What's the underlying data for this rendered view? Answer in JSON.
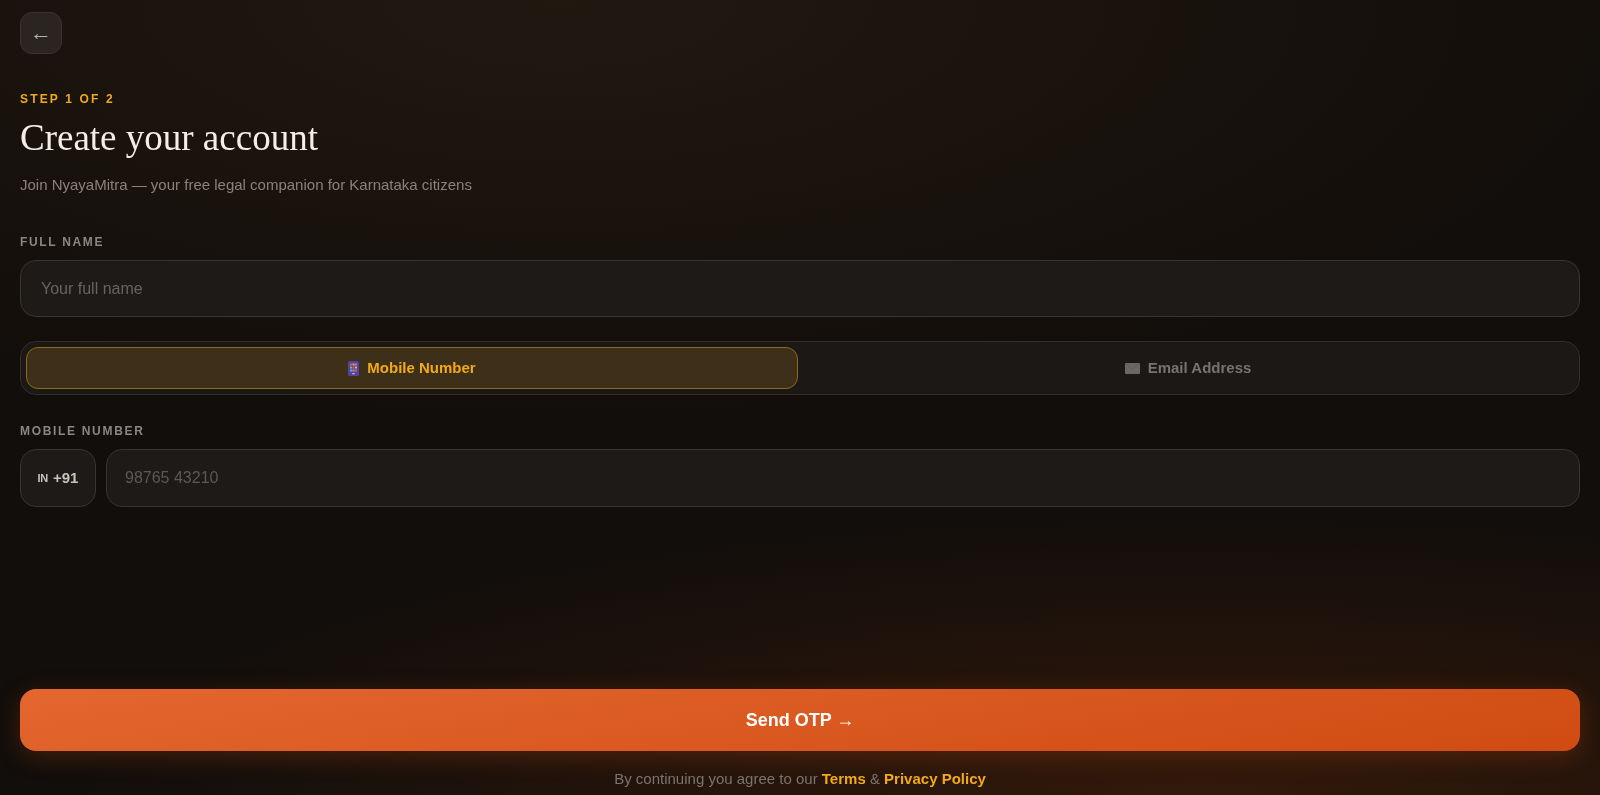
{
  "back_button": {
    "label": "←"
  },
  "header": {
    "step": "STEP 1 OF 2",
    "title": "Create your account",
    "subtitle": "Join NyayaMitra — your free legal companion for Karnataka citizens"
  },
  "full_name": {
    "label": "FULL NAME",
    "placeholder": "Your full name"
  },
  "contact_tabs": [
    {
      "kind": "phone",
      "label": "Mobile Number",
      "selected": true
    },
    {
      "kind": "mail",
      "label": "Email Address",
      "selected": false
    }
  ],
  "mobile_number": {
    "label": "MOBILE NUMBER",
    "country_flag": "IN",
    "country_code": "+91",
    "placeholder": "98765 43210"
  },
  "submit_button": {
    "label": "Send OTP →"
  },
  "footer": {
    "text": "By continuing you agree to our",
    "links": [
      {
        "label": "Terms"
      },
      {
        "label": "Privacy Policy"
      }
    ],
    "separator": "&"
  }
}
